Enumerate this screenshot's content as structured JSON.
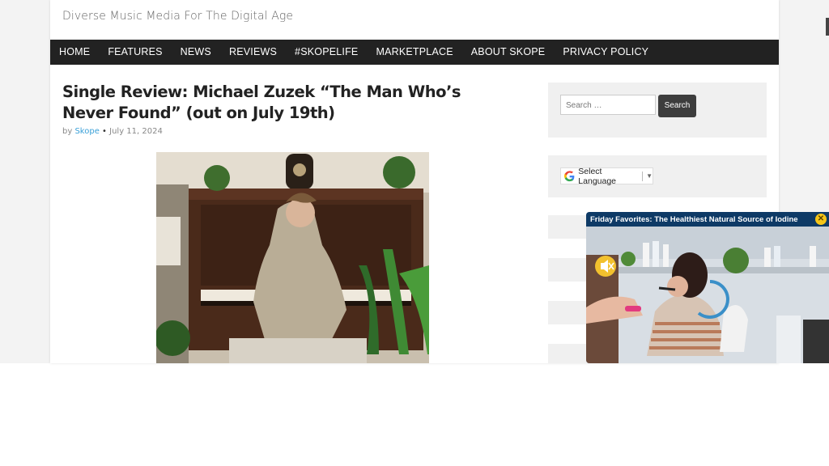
{
  "site": {
    "tagline": "Diverse Music Media For The Digital Age"
  },
  "nav": {
    "items": [
      "HOME",
      "FEATURES",
      "NEWS",
      "REVIEWS",
      "#SKOPELIFE",
      "MARKETPLACE",
      "ABOUT SKOPE",
      "PRIVACY POLICY"
    ]
  },
  "post": {
    "title": "Single Review: Michael Zuzek “The Man Who’s Never Found” (out on July 19th)",
    "by": "by",
    "author": "Skope",
    "separator": "•",
    "date": "July 11, 2024"
  },
  "sidebar": {
    "search_placeholder": "Search …",
    "search_button": "Search",
    "language_label": "Select Language",
    "language_caret": "▼"
  },
  "video_ad": {
    "title": "Friday Favorites: The Healthiest Natural Source of Iodine",
    "close_glyph": "✕"
  },
  "colors": {
    "nav_bg": "#222222",
    "link_blue": "#3aa0d8",
    "search_button_bg": "#3d3d3d",
    "ad_header_bg": "#0e3a66",
    "ad_close": "#f5c518"
  }
}
